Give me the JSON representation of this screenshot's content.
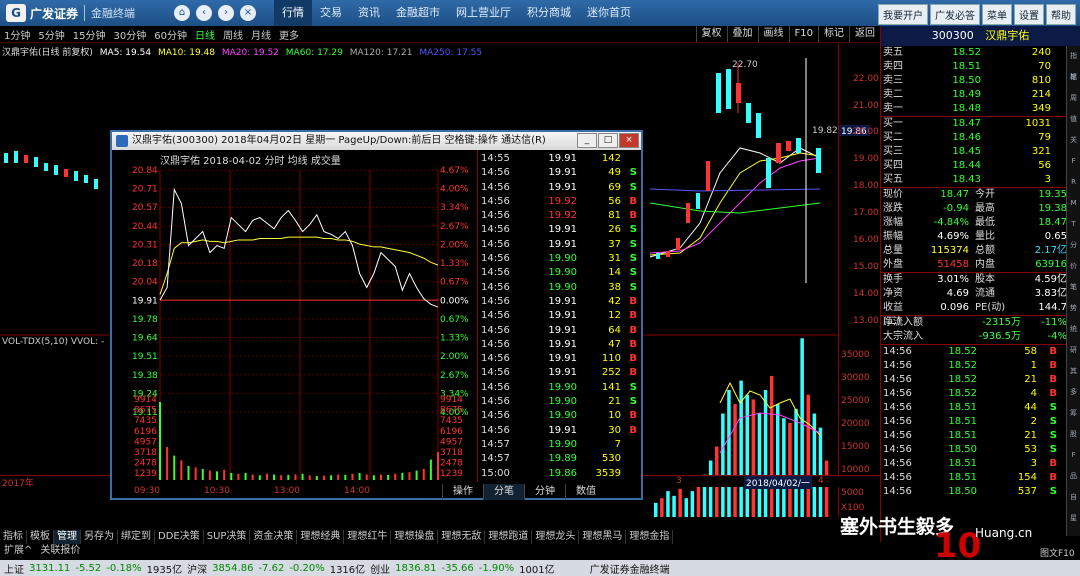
{
  "app": {
    "logo": "广发证券",
    "sub": "金融终端",
    "nav": [
      "行情",
      "交易",
      "资讯",
      "金融超市",
      "网上营业厅",
      "积分商城",
      "迷你首页"
    ],
    "top_right": [
      "我要开户",
      "广发必答",
      "菜单",
      "设置",
      "帮助"
    ]
  },
  "periods": [
    "1分钟",
    "5分钟",
    "15分钟",
    "30分钟",
    "60分钟",
    "日线",
    "周线",
    "月线",
    "更多"
  ],
  "active_period": "日线",
  "tools": [
    "复权",
    "叠加",
    "画线",
    "F10",
    "标记",
    "返回"
  ],
  "main": {
    "stock": "汉鼎宇佑(日线 前复权)",
    "ma": [
      {
        "label": "MA5: 19.54",
        "color": "#ffffff"
      },
      {
        "label": "MA10: 19.48",
        "color": "#ffff33"
      },
      {
        "label": "MA20: 19.52",
        "color": "#ff44ff"
      },
      {
        "label": "MA60: 17.29",
        "color": "#33ff33"
      },
      {
        "label": "MA120: 17.21",
        "color": "#aaaaaa"
      },
      {
        "label": "MA250: 17.55",
        "color": "#3333ff"
      }
    ],
    "price_axis": [
      "22.00",
      "21.00",
      "20.00",
      "19.00",
      "18.00",
      "17.00",
      "16.00",
      "15.00",
      "14.00",
      "13.00"
    ],
    "high_label": "22.70",
    "cur_label": "19.82",
    "cur_tag": "19.86",
    "vol_label": "VOL-TDX(5,10)  VVOL: -",
    "vol_axis": [
      "35000",
      "30000",
      "25000",
      "20000",
      "15000",
      "10000",
      "5000",
      "X100"
    ],
    "dates": [
      "2017年",
      "11",
      "12",
      "1",
      "2",
      "3",
      "2018/04/02/一",
      "4"
    ]
  },
  "popup": {
    "title": "汉鼎宇佑(300300) 2018年04月02日 星期一 PageUp/Down:前后日 空格键:操作 通达信(R)",
    "header": "汉鼎宇佑  2018-04-02 分时  均线  成交量",
    "price_axis": [
      "20.84",
      "20.71",
      "20.57",
      "20.44",
      "20.31",
      "20.18",
      "20.04",
      "19.91",
      "19.78",
      "19.64",
      "19.51",
      "19.38",
      "19.24",
      "19.11"
    ],
    "pct_axis": [
      "4.67%",
      "4.00%",
      "3.34%",
      "2.67%",
      "2.00%",
      "1.33%",
      "0.67%",
      "0.00%",
      "0.67%",
      "1.33%",
      "2.00%",
      "2.67%",
      "3.34%",
      "4.00%"
    ],
    "vol_axis": [
      "9914",
      "8675",
      "7435",
      "6196",
      "4957",
      "3718",
      "2478",
      "1239"
    ],
    "times": [
      "09:30",
      "10:30",
      "13:00",
      "14:00"
    ],
    "tabs": [
      "操作",
      "分笔",
      "分钟",
      "数值"
    ],
    "ticks": [
      {
        "t": "14:55",
        "p": "19.91",
        "v": "142",
        "s": "",
        "pc": "#ffffff"
      },
      {
        "t": "14:56",
        "p": "19.91",
        "v": "49",
        "s": "S",
        "pc": "#ffffff"
      },
      {
        "t": "14:56",
        "p": "19.91",
        "v": "69",
        "s": "S",
        "pc": "#ffffff"
      },
      {
        "t": "14:56",
        "p": "19.92",
        "v": "56",
        "s": "B",
        "pc": "#ff3333"
      },
      {
        "t": "14:56",
        "p": "19.92",
        "v": "81",
        "s": "B",
        "pc": "#ff3333"
      },
      {
        "t": "14:56",
        "p": "19.91",
        "v": "26",
        "s": "S",
        "pc": "#ffffff"
      },
      {
        "t": "14:56",
        "p": "19.91",
        "v": "37",
        "s": "S",
        "pc": "#ffffff"
      },
      {
        "t": "14:56",
        "p": "19.90",
        "v": "31",
        "s": "S",
        "pc": "#33ff33"
      },
      {
        "t": "14:56",
        "p": "19.90",
        "v": "14",
        "s": "S",
        "pc": "#33ff33"
      },
      {
        "t": "14:56",
        "p": "19.90",
        "v": "38",
        "s": "S",
        "pc": "#33ff33"
      },
      {
        "t": "14:56",
        "p": "19.91",
        "v": "42",
        "s": "B",
        "pc": "#ffffff"
      },
      {
        "t": "14:56",
        "p": "19.91",
        "v": "12",
        "s": "B",
        "pc": "#ffffff"
      },
      {
        "t": "14:56",
        "p": "19.91",
        "v": "64",
        "s": "B",
        "pc": "#ffffff"
      },
      {
        "t": "14:56",
        "p": "19.91",
        "v": "47",
        "s": "B",
        "pc": "#ffffff"
      },
      {
        "t": "14:56",
        "p": "19.91",
        "v": "110",
        "s": "B",
        "pc": "#ffffff"
      },
      {
        "t": "14:56",
        "p": "19.91",
        "v": "252",
        "s": "B",
        "pc": "#ffffff"
      },
      {
        "t": "14:56",
        "p": "19.90",
        "v": "141",
        "s": "S",
        "pc": "#33ff33"
      },
      {
        "t": "14:56",
        "p": "19.90",
        "v": "21",
        "s": "S",
        "pc": "#33ff33"
      },
      {
        "t": "14:56",
        "p": "19.90",
        "v": "10",
        "s": "B",
        "pc": "#33ff33"
      },
      {
        "t": "14:56",
        "p": "19.91",
        "v": "30",
        "s": "B",
        "pc": "#ffffff"
      },
      {
        "t": "14:57",
        "p": "19.90",
        "v": "7",
        "s": "",
        "pc": "#33ff33"
      },
      {
        "t": "14:57",
        "p": "19.89",
        "v": "530",
        "s": "",
        "pc": "#33ff33"
      },
      {
        "t": "15:00",
        "p": "19.86",
        "v": "3539",
        "s": "",
        "pc": "#33ff33"
      }
    ]
  },
  "panel": {
    "code": "300300",
    "name": "汉鼎宇佑",
    "asks": [
      {
        "l": "卖五",
        "p": "18.52",
        "v": "240"
      },
      {
        "l": "卖四",
        "p": "18.51",
        "v": "70"
      },
      {
        "l": "卖三",
        "p": "18.50",
        "v": "810"
      },
      {
        "l": "卖二",
        "p": "18.49",
        "v": "214"
      },
      {
        "l": "卖一",
        "p": "18.48",
        "v": "349"
      }
    ],
    "bids": [
      {
        "l": "买一",
        "p": "18.47",
        "v": "1031"
      },
      {
        "l": "买二",
        "p": "18.46",
        "v": "79"
      },
      {
        "l": "买三",
        "p": "18.45",
        "v": "321"
      },
      {
        "l": "买四",
        "p": "18.44",
        "v": "56"
      },
      {
        "l": "买五",
        "p": "18.43",
        "v": "3"
      }
    ],
    "stats": [
      {
        "l": "现价",
        "v": "18.47",
        "c": "#33ff33",
        "l2": "今开",
        "v2": "19.35",
        "c2": "#33ff33"
      },
      {
        "l": "涨跌",
        "v": "-0.94",
        "c": "#33ff33",
        "l2": "最高",
        "v2": "19.38",
        "c2": "#33ff33"
      },
      {
        "l": "涨幅",
        "v": "-4.84%",
        "c": "#33ff33",
        "l2": "最低",
        "v2": "18.47",
        "c2": "#33ff33"
      },
      {
        "l": "振幅",
        "v": "4.69%",
        "c": "#ffffff",
        "l2": "量比",
        "v2": "0.65",
        "c2": "#ffffff"
      },
      {
        "l": "总量",
        "v": "115374",
        "c": "#ffff33",
        "l2": "总额",
        "v2": "2.17亿",
        "c2": "#33ddff"
      },
      {
        "l": "外盘",
        "v": "51458",
        "c": "#ff3333",
        "l2": "内盘",
        "v2": "63916",
        "c2": "#33ff33"
      }
    ],
    "stats2": [
      {
        "l": "换手",
        "v": "3.01%",
        "l2": "股本",
        "v2": "4.59亿"
      },
      {
        "l": "净资",
        "v": "4.69",
        "l2": "流通",
        "v2": "3.83亿"
      },
      {
        "l": "收益(二)",
        "v": "0.096",
        "l2": "PE(动)",
        "v2": "144.7"
      }
    ],
    "flows": [
      {
        "l": "净流入额",
        "v": "-2315万",
        "p": "-11%"
      },
      {
        "l": "大宗流入",
        "v": "-936.5万",
        "p": "-4%"
      }
    ],
    "ticks": [
      {
        "t": "14:56",
        "p": "18.52",
        "v": "58",
        "s": "B",
        "sc": "#ff3333"
      },
      {
        "t": "14:56",
        "p": "18.52",
        "v": "1",
        "s": "B",
        "sc": "#ff3333"
      },
      {
        "t": "14:56",
        "p": "18.52",
        "v": "21",
        "s": "B",
        "sc": "#ff3333"
      },
      {
        "t": "14:56",
        "p": "18.52",
        "v": "4",
        "s": "B",
        "sc": "#ff3333"
      },
      {
        "t": "14:56",
        "p": "18.51",
        "v": "44",
        "s": "S",
        "sc": "#33ff33"
      },
      {
        "t": "14:56",
        "p": "18.51",
        "v": "2",
        "s": "S",
        "sc": "#33ff33"
      },
      {
        "t": "14:56",
        "p": "18.51",
        "v": "21",
        "s": "S",
        "sc": "#33ff33"
      },
      {
        "t": "14:56",
        "p": "18.50",
        "v": "53",
        "s": "S",
        "sc": "#33ff33"
      },
      {
        "t": "14:56",
        "p": "18.51",
        "v": "3",
        "s": "B",
        "sc": "#ff3333"
      },
      {
        "t": "14:56",
        "p": "18.51",
        "v": "154",
        "s": "B",
        "sc": "#ff3333"
      },
      {
        "t": "14:56",
        "p": "18.50",
        "v": "537",
        "s": "S",
        "sc": "#33ff33"
      }
    ],
    "side_strip": [
      "指标",
      "笔",
      "周",
      "值",
      "关",
      "F",
      "R",
      "M",
      "T",
      "分",
      "价",
      "笔",
      "势",
      "统",
      "研",
      "其",
      "多",
      "筹",
      "股",
      "F",
      "品",
      "自",
      "星",
      "RSI",
      "小"
    ],
    "bottom_right": "图文F10"
  },
  "tabs1": [
    "指标",
    "模板",
    "管理",
    "另存为",
    "绑定到",
    "DDE决策",
    "SUP决策",
    "资金决策",
    "理想经典",
    "理想红牛",
    "理想操盘",
    "理想无敌",
    "理想跑道",
    "理想龙头",
    "理想黑马",
    "理想金指"
  ],
  "tabs2": [
    "扩展^",
    "关联报价"
  ],
  "status": {
    "sh_label": "上证",
    "sh": "3131.11",
    "sh_chg": "-5.52",
    "sh_pct": "-0.18%",
    "sh_amt": "1935亿",
    "sz_label": "沪深",
    "sz": "3854.86",
    "sz_chg": "-7.62",
    "sz_pct": "-0.20%",
    "sz_amt": "1316亿",
    "cy_label": "创业",
    "cy": "1836.81",
    "cy_chg": "-35.66",
    "cy_pct": "-1.90%",
    "cy_amt": "1001亿",
    "brand": "广发证券金融终端"
  },
  "watermark": {
    "text1": "塞外书生毅多",
    "text2": "Huang.cn"
  },
  "colors": {
    "accent": "#1d4f86",
    "up": "#ff3333",
    "down": "#33ff33",
    "axis": "#cc3333"
  },
  "chart_data": [
    {
      "type": "line",
      "title": "汉鼎宇佑  2018-04-02 分时",
      "price_range": [
        19.11,
        20.84
      ],
      "prev_close": 19.91,
      "minute_price": [
        19.91,
        20.0,
        20.7,
        20.6,
        20.3,
        20.35,
        20.4,
        20.25,
        20.3,
        20.28,
        20.5,
        20.45,
        20.4,
        20.48,
        20.5,
        20.46,
        20.42,
        20.5,
        20.55,
        20.48,
        20.4,
        20.45,
        20.52,
        20.4,
        20.38,
        20.35,
        20.4,
        20.3,
        20.1,
        20.0,
        20.1,
        20.25,
        20.2,
        20.15,
        19.98,
        20.1,
        20.0,
        19.92,
        19.88,
        19.86
      ],
      "avg_price": [
        19.95,
        20.1,
        20.28,
        20.32,
        20.32,
        20.33,
        20.34,
        20.33,
        20.33,
        20.32,
        20.33,
        20.34,
        20.34,
        20.34,
        20.35,
        20.35,
        20.35,
        20.35,
        20.36,
        20.36,
        20.36,
        20.36,
        20.36,
        20.35,
        20.35,
        20.34,
        20.34,
        20.33,
        20.31,
        20.3,
        20.29,
        20.29,
        20.28,
        20.27,
        20.26,
        20.25,
        20.23,
        20.21,
        20.18,
        20.16
      ],
      "volume": [
        9914,
        4200,
        3100,
        2500,
        1800,
        1600,
        1400,
        1200,
        1100,
        1300,
        900,
        800,
        900,
        700,
        600,
        800,
        700,
        600,
        650,
        700,
        800,
        600,
        500,
        550,
        600,
        700,
        650,
        800,
        900,
        700,
        600,
        700,
        650,
        800,
        900,
        1000,
        1200,
        1400,
        2600,
        3539
      ],
      "vol_range": [
        0,
        9914
      ]
    },
    {
      "type": "bar",
      "title": "VOL-TDX(5,10)",
      "vol_range": [
        0,
        37000
      ],
      "values": [
        3000,
        4000,
        5500,
        4500,
        6000,
        4000,
        5500,
        7000,
        9000,
        12000,
        15000,
        22000,
        27000,
        24000,
        29000,
        26000,
        25000,
        22000,
        27000,
        30000,
        24000,
        21000,
        20000,
        23000,
        38000,
        26000,
        22000,
        19000,
        12000
      ]
    }
  ]
}
